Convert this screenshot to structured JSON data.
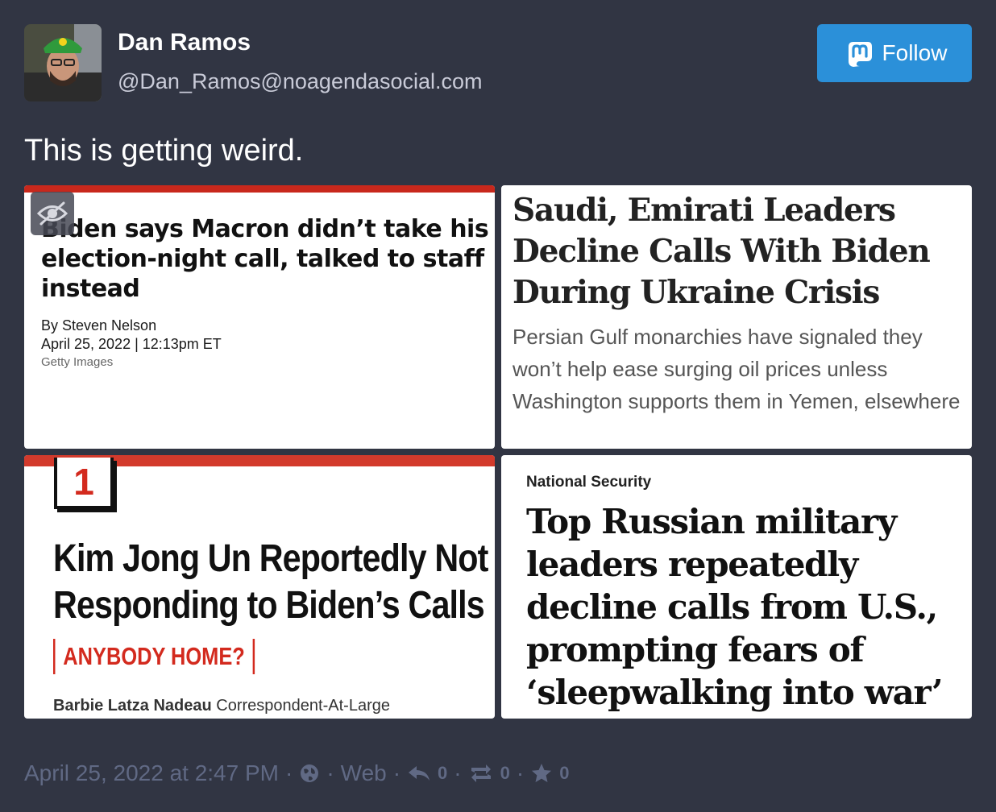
{
  "author": {
    "display_name": "Dan Ramos",
    "handle": "@Dan_Ramos@noagendasocial.com"
  },
  "follow_button": {
    "label": "Follow"
  },
  "status": {
    "text": "This is getting weird."
  },
  "media": [
    {
      "headline": "Biden says Macron didn’t take his election-night call, talked to staff instead",
      "byline": "By Steven Nelson",
      "dateline": "April 25, 2022 | 12:13pm ET",
      "credit": "Getty Images"
    },
    {
      "headline": "Saudi, Emirati Leaders Decline Calls With Biden During Ukraine Crisis",
      "dek": "Persian Gulf monarchies have signaled they won’t help ease surging oil prices unless Washington supports them in Yemen, elsewhere"
    },
    {
      "rank": "1",
      "headline_line1": "Kim Jong Un Reportedly Not",
      "headline_line2": "Responding to Biden’s Calls",
      "kicker": "ANYBODY HOME?",
      "author_name": "Barbie Latza Nadeau",
      "author_title": "Correspondent-At-Large"
    },
    {
      "section": "National Security",
      "headline": "Top Russian military leaders repeatedly decline calls from U.S., prompting fears of ‘sleepwalking into war’"
    }
  ],
  "footer": {
    "timestamp": "April 25, 2022 at 2:47 PM",
    "visibility_icon": "globe-icon",
    "application": "Web",
    "reply_count": "0",
    "reblog_count": "0",
    "favourite_count": "0"
  },
  "colors": {
    "background": "#313543",
    "accent": "#2b90d9",
    "muted": "#606984"
  }
}
